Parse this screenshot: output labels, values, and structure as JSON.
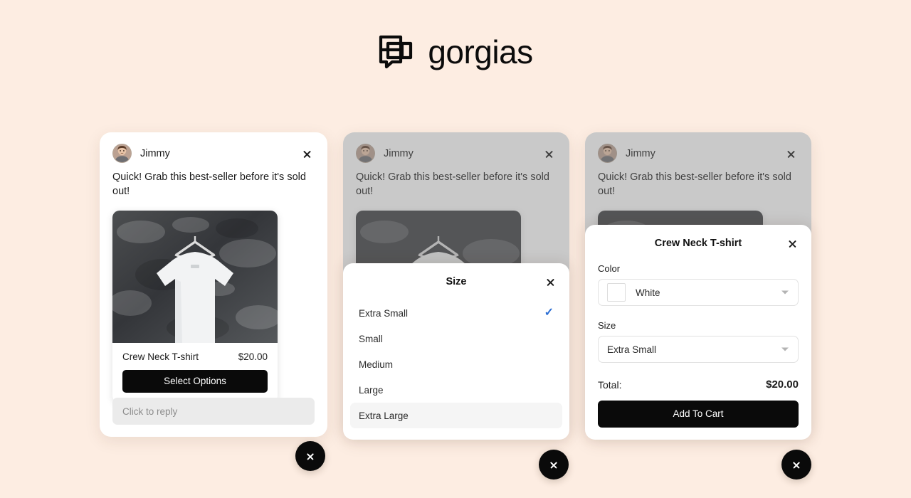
{
  "brand": {
    "name": "gorgias",
    "logo_icon": "gorgias-chat-squares-logo"
  },
  "colors": {
    "page_background": "#FDEDE2",
    "card_background": "#FFFFFF",
    "button_black": "#0A0A0A",
    "check_blue": "#2D6FD4",
    "reply_field": "#EBEBEB",
    "highlight_row": "#F5F5F5"
  },
  "chat": {
    "agent_name": "Jimmy",
    "message": "Quick! Grab this best-seller before it's sold out!",
    "close_icon": "close-icon",
    "avatar_icon": "avatar-photo"
  },
  "product": {
    "title": "Crew Neck T-shirt",
    "price": "$20.00",
    "select_options_label": "Select Options",
    "image_alt": "white-crew-neck-tshirt-on-hanger"
  },
  "reply": {
    "placeholder": "Click to reply"
  },
  "size_modal": {
    "title": "Size",
    "close_icon": "close-icon",
    "options": [
      {
        "label": "Extra Small",
        "selected": true,
        "highlighted": false
      },
      {
        "label": "Small",
        "selected": false,
        "highlighted": false
      },
      {
        "label": "Medium",
        "selected": false,
        "highlighted": false
      },
      {
        "label": "Large",
        "selected": false,
        "highlighted": false
      },
      {
        "label": "Extra Large",
        "selected": false,
        "highlighted": true
      }
    ],
    "check_icon": "check-icon"
  },
  "options_modal": {
    "title": "Crew Neck T-shirt",
    "close_icon": "close-icon",
    "color_label": "Color",
    "color_value": "White",
    "color_swatch_hex": "#FFFFFF",
    "size_label": "Size",
    "size_value": "Extra Small",
    "total_label": "Total:",
    "total_value": "$20.00",
    "add_to_cart_label": "Add To Cart",
    "caret_icon": "chevron-down-icon"
  },
  "launcher": {
    "icon": "close-icon"
  }
}
